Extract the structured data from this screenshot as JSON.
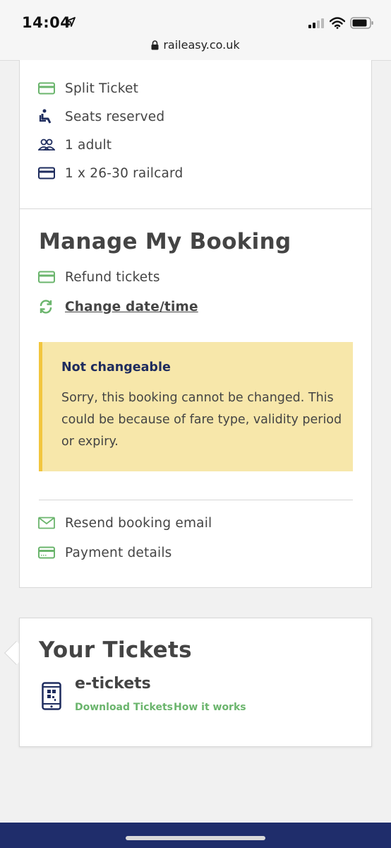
{
  "status_bar": {
    "time": "14:04",
    "url": "raileasy.co.uk"
  },
  "summary": {
    "items": [
      {
        "icon": "ticket-icon",
        "label": "Split Ticket"
      },
      {
        "icon": "seat-icon",
        "label": "Seats reserved"
      },
      {
        "icon": "passengers-icon",
        "label": "1 adult"
      },
      {
        "icon": "railcard-icon",
        "label": "1 x 26-30 railcard"
      }
    ]
  },
  "manage": {
    "title": "Manage My Booking",
    "refund_label": "Refund tickets",
    "change_label": "Change date/time",
    "alert": {
      "title": "Not changeable",
      "text": "Sorry, this booking cannot be changed. This could be because of fare type, validity period or expiry."
    },
    "resend_label": "Resend booking email",
    "payment_label": "Payment details"
  },
  "tickets": {
    "title": "Your Tickets",
    "type": "e-tickets",
    "download_label": "Download Tickets",
    "how_label": "How it works"
  },
  "colors": {
    "green": "#6bb56d",
    "navy": "#1e2c5e",
    "alert_bg": "#f7e7aa",
    "alert_border": "#f2c63e"
  }
}
